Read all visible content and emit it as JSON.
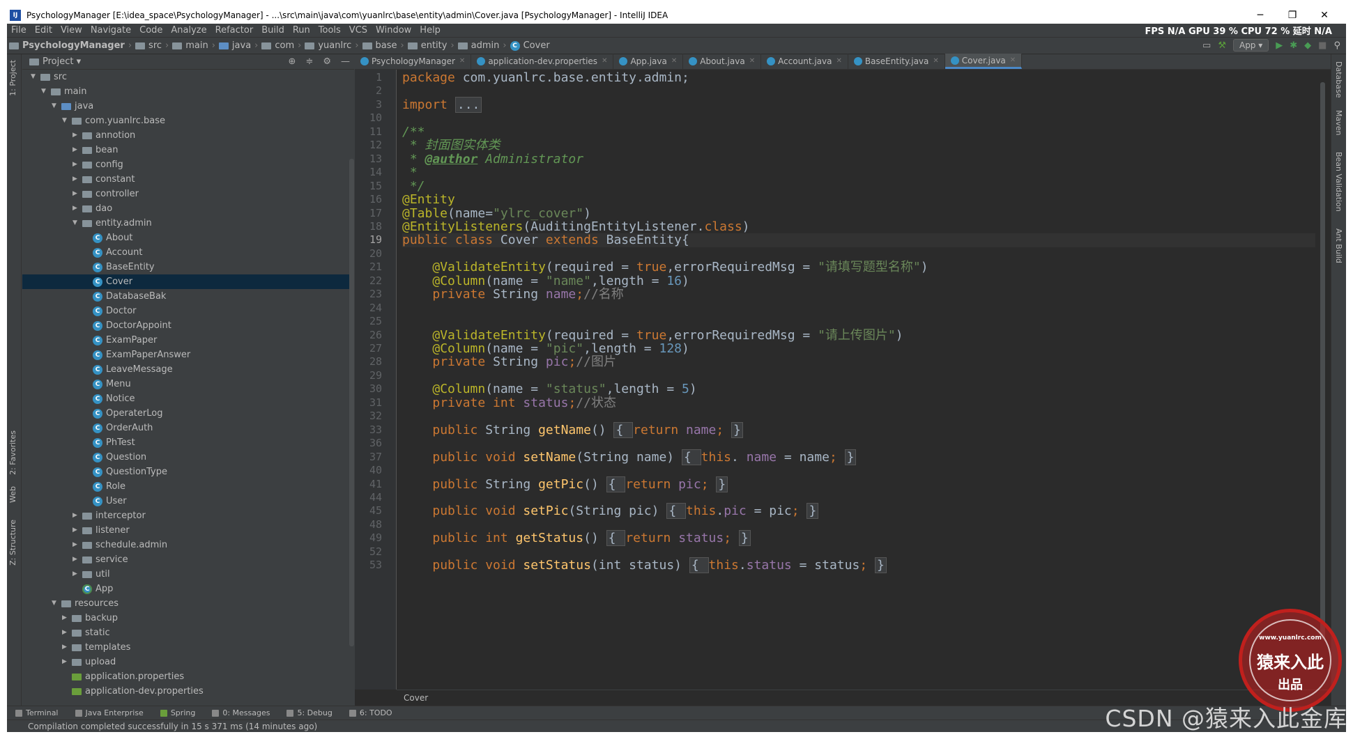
{
  "window": {
    "title": "PsychologyManager [E:\\idea_space\\PsychologyManager] - ...\\src\\main\\java\\com\\yuanlrc\\base\\entity\\admin\\Cover.java [PsychologyManager] - IntelliJ IDEA",
    "app_icon": "IJ",
    "minimize": "─",
    "restore": "❐",
    "close": "✕"
  },
  "menu": {
    "items": [
      "File",
      "Edit",
      "View",
      "Navigate",
      "Code",
      "Analyze",
      "Refactor",
      "Build",
      "Run",
      "Tools",
      "VCS",
      "Window",
      "Help"
    ],
    "stats": "FPS N/A GPU 39 % CPU 72 % 延时 N/A"
  },
  "nav": {
    "crumbs": [
      "PsychologyManager",
      "src",
      "main",
      "java",
      "com",
      "yuanlrc",
      "base",
      "entity",
      "admin",
      "Cover"
    ],
    "run_config": "App ▾"
  },
  "left_strip": {
    "project": "1: Project",
    "favorites": "2: Favorites",
    "web": "Web",
    "structure": "Z: Structure"
  },
  "right_strip": {
    "database": "Database",
    "maven": "Maven",
    "bean_validation": "Bean Validation",
    "ant_build": "Ant Build"
  },
  "project_panel": {
    "title": "Project ▾",
    "tree": [
      {
        "label": "src",
        "depth": 0,
        "type": "folder",
        "open": true
      },
      {
        "label": "main",
        "depth": 1,
        "type": "folder",
        "open": true
      },
      {
        "label": "java",
        "depth": 2,
        "type": "folder-blue",
        "open": true
      },
      {
        "label": "com.yuanlrc.base",
        "depth": 3,
        "type": "folder",
        "open": true
      },
      {
        "label": "annotion",
        "depth": 4,
        "type": "folder",
        "open": false
      },
      {
        "label": "bean",
        "depth": 4,
        "type": "folder",
        "open": false
      },
      {
        "label": "config",
        "depth": 4,
        "type": "folder",
        "open": false
      },
      {
        "label": "constant",
        "depth": 4,
        "type": "folder",
        "open": false
      },
      {
        "label": "controller",
        "depth": 4,
        "type": "folder",
        "open": false
      },
      {
        "label": "dao",
        "depth": 4,
        "type": "folder",
        "open": false
      },
      {
        "label": "entity.admin",
        "depth": 4,
        "type": "folder",
        "open": true
      },
      {
        "label": "About",
        "depth": 5,
        "type": "class"
      },
      {
        "label": "Account",
        "depth": 5,
        "type": "class"
      },
      {
        "label": "BaseEntity",
        "depth": 5,
        "type": "class"
      },
      {
        "label": "Cover",
        "depth": 5,
        "type": "class",
        "selected": true
      },
      {
        "label": "DatabaseBak",
        "depth": 5,
        "type": "class"
      },
      {
        "label": "Doctor",
        "depth": 5,
        "type": "class"
      },
      {
        "label": "DoctorAppoint",
        "depth": 5,
        "type": "class"
      },
      {
        "label": "ExamPaper",
        "depth": 5,
        "type": "class"
      },
      {
        "label": "ExamPaperAnswer",
        "depth": 5,
        "type": "class"
      },
      {
        "label": "LeaveMessage",
        "depth": 5,
        "type": "class"
      },
      {
        "label": "Menu",
        "depth": 5,
        "type": "class"
      },
      {
        "label": "Notice",
        "depth": 5,
        "type": "class"
      },
      {
        "label": "OperaterLog",
        "depth": 5,
        "type": "class"
      },
      {
        "label": "OrderAuth",
        "depth": 5,
        "type": "class"
      },
      {
        "label": "PhTest",
        "depth": 5,
        "type": "class"
      },
      {
        "label": "Question",
        "depth": 5,
        "type": "class"
      },
      {
        "label": "QuestionType",
        "depth": 5,
        "type": "class"
      },
      {
        "label": "Role",
        "depth": 5,
        "type": "class"
      },
      {
        "label": "User",
        "depth": 5,
        "type": "class"
      },
      {
        "label": "interceptor",
        "depth": 4,
        "type": "folder",
        "open": false
      },
      {
        "label": "listener",
        "depth": 4,
        "type": "folder",
        "open": false
      },
      {
        "label": "schedule.admin",
        "depth": 4,
        "type": "folder",
        "open": false
      },
      {
        "label": "service",
        "depth": 4,
        "type": "folder",
        "open": false
      },
      {
        "label": "util",
        "depth": 4,
        "type": "folder",
        "open": false
      },
      {
        "label": "App",
        "depth": 4,
        "type": "app"
      },
      {
        "label": "resources",
        "depth": 2,
        "type": "folder",
        "open": true
      },
      {
        "label": "backup",
        "depth": 3,
        "type": "folder",
        "open": false
      },
      {
        "label": "static",
        "depth": 3,
        "type": "folder",
        "open": false
      },
      {
        "label": "templates",
        "depth": 3,
        "type": "folder",
        "open": false
      },
      {
        "label": "upload",
        "depth": 3,
        "type": "folder",
        "open": false
      },
      {
        "label": "application.properties",
        "depth": 3,
        "type": "props"
      },
      {
        "label": "application-dev.properties",
        "depth": 3,
        "type": "props"
      }
    ]
  },
  "editor": {
    "tabs": [
      {
        "label": "PsychologyManager",
        "active": false
      },
      {
        "label": "application-dev.properties",
        "active": false
      },
      {
        "label": "App.java",
        "active": false
      },
      {
        "label": "About.java",
        "active": false
      },
      {
        "label": "Account.java",
        "active": false
      },
      {
        "label": "BaseEntity.java",
        "active": false
      },
      {
        "label": "Cover.java",
        "active": true
      }
    ],
    "current_line": "19",
    "breadcrumb": "Cover",
    "lines": [
      {
        "n": "1",
        "tokens": [
          [
            "kw",
            "package "
          ],
          [
            "",
            "com.yuanlrc.base.entity.admin;"
          ]
        ]
      },
      {
        "n": "2",
        "tokens": []
      },
      {
        "n": "3",
        "tokens": [
          [
            "kw",
            "import "
          ],
          [
            "fb",
            "..."
          ]
        ]
      },
      {
        "n": "10",
        "tokens": []
      },
      {
        "n": "11",
        "tokens": [
          [
            "doc",
            "/**"
          ]
        ]
      },
      {
        "n": "12",
        "tokens": [
          [
            "doc",
            " * 封面图实体类"
          ]
        ]
      },
      {
        "n": "13",
        "tokens": [
          [
            "doc",
            " * "
          ],
          [
            "tag",
            "@author"
          ],
          [
            "doc",
            " Administrator"
          ]
        ]
      },
      {
        "n": "14",
        "tokens": [
          [
            "doc",
            " *"
          ]
        ]
      },
      {
        "n": "15",
        "tokens": [
          [
            "doc",
            " */"
          ]
        ]
      },
      {
        "n": "16",
        "tokens": [
          [
            "an",
            "@Entity"
          ]
        ]
      },
      {
        "n": "17",
        "tokens": [
          [
            "an",
            "@Table"
          ],
          [
            "",
            "(name="
          ],
          [
            "str",
            "\"ylrc_cover\""
          ],
          [
            "",
            ")"
          ]
        ]
      },
      {
        "n": "18",
        "tokens": [
          [
            "an",
            "@EntityListeners"
          ],
          [
            "",
            "(AuditingEntityListener."
          ],
          [
            "kw",
            "class"
          ],
          [
            "",
            ")"
          ]
        ]
      },
      {
        "n": "19",
        "tokens": [
          [
            "kw",
            "public class "
          ],
          [
            "",
            "Cover "
          ],
          [
            "kw",
            "extends "
          ],
          [
            "",
            "BaseEntity{"
          ]
        ]
      },
      {
        "n": "20",
        "tokens": []
      },
      {
        "n": "21",
        "tokens": [
          [
            "",
            "    "
          ],
          [
            "an",
            "@ValidateEntity"
          ],
          [
            "",
            "(required = "
          ],
          [
            "kw",
            "true"
          ],
          [
            "",
            ",errorRequiredMsg = "
          ],
          [
            "str",
            "\"请填写题型名称\""
          ],
          [
            "",
            ")"
          ]
        ]
      },
      {
        "n": "22",
        "tokens": [
          [
            "",
            "    "
          ],
          [
            "an",
            "@Column"
          ],
          [
            "",
            "(name = "
          ],
          [
            "str",
            "\"name\""
          ],
          [
            "",
            ",length = "
          ],
          [
            "num",
            "16"
          ],
          [
            "",
            ")"
          ]
        ]
      },
      {
        "n": "23",
        "tokens": [
          [
            "",
            "    "
          ],
          [
            "kw",
            "private "
          ],
          [
            "",
            "String "
          ],
          [
            "fld",
            "name"
          ],
          [
            "kw",
            ";"
          ],
          [
            "cm",
            "//名称"
          ]
        ]
      },
      {
        "n": "24",
        "tokens": []
      },
      {
        "n": "25",
        "tokens": []
      },
      {
        "n": "26",
        "tokens": [
          [
            "",
            "    "
          ],
          [
            "an",
            "@ValidateEntity"
          ],
          [
            "",
            "(required = "
          ],
          [
            "kw",
            "true"
          ],
          [
            "",
            ",errorRequiredMsg = "
          ],
          [
            "str",
            "\"请上传图片\""
          ],
          [
            "",
            ")"
          ]
        ]
      },
      {
        "n": "27",
        "tokens": [
          [
            "",
            "    "
          ],
          [
            "an",
            "@Column"
          ],
          [
            "",
            "(name = "
          ],
          [
            "str",
            "\"pic\""
          ],
          [
            "",
            ",length = "
          ],
          [
            "num",
            "128"
          ],
          [
            "",
            ")"
          ]
        ]
      },
      {
        "n": "28",
        "tokens": [
          [
            "",
            "    "
          ],
          [
            "kw",
            "private "
          ],
          [
            "",
            "String "
          ],
          [
            "fld",
            "pic"
          ],
          [
            "kw",
            ";"
          ],
          [
            "cm",
            "//图片"
          ]
        ]
      },
      {
        "n": "29",
        "tokens": []
      },
      {
        "n": "30",
        "tokens": [
          [
            "",
            "    "
          ],
          [
            "an",
            "@Column"
          ],
          [
            "",
            "(name = "
          ],
          [
            "str",
            "\"status\""
          ],
          [
            "",
            ",length = "
          ],
          [
            "num",
            "5"
          ],
          [
            "",
            ")"
          ]
        ]
      },
      {
        "n": "31",
        "tokens": [
          [
            "",
            "    "
          ],
          [
            "kw",
            "private int "
          ],
          [
            "fld",
            "status"
          ],
          [
            "kw",
            ";"
          ],
          [
            "cm",
            "//状态"
          ]
        ]
      },
      {
        "n": "32",
        "tokens": []
      },
      {
        "n": "33",
        "tokens": [
          [
            "",
            "    "
          ],
          [
            "kw",
            "public "
          ],
          [
            "",
            "String "
          ],
          [
            "mth",
            "getName"
          ],
          [
            "",
            "() "
          ],
          [
            "fb",
            "{ "
          ],
          [
            "kw",
            "return "
          ],
          [
            "fld",
            "name"
          ],
          [
            "kw",
            "; "
          ],
          [
            "fb",
            "}"
          ]
        ]
      },
      {
        "n": "36",
        "tokens": []
      },
      {
        "n": "37",
        "tokens": [
          [
            "",
            "    "
          ],
          [
            "kw",
            "public void "
          ],
          [
            "mth",
            "setName"
          ],
          [
            "",
            "(String name) "
          ],
          [
            "fb",
            "{ "
          ],
          [
            "kw",
            "this"
          ],
          [
            "",
            ". "
          ],
          [
            "fld",
            "name"
          ],
          [
            "",
            " = name"
          ],
          [
            "kw",
            "; "
          ],
          [
            "fb",
            "}"
          ]
        ]
      },
      {
        "n": "40",
        "tokens": []
      },
      {
        "n": "41",
        "tokens": [
          [
            "",
            "    "
          ],
          [
            "kw",
            "public "
          ],
          [
            "",
            "String "
          ],
          [
            "mth",
            "getPic"
          ],
          [
            "",
            "() "
          ],
          [
            "fb",
            "{ "
          ],
          [
            "kw",
            "return "
          ],
          [
            "fld",
            "pic"
          ],
          [
            "kw",
            "; "
          ],
          [
            "fb",
            "}"
          ]
        ]
      },
      {
        "n": "44",
        "tokens": []
      },
      {
        "n": "45",
        "tokens": [
          [
            "",
            "    "
          ],
          [
            "kw",
            "public void "
          ],
          [
            "mth",
            "setPic"
          ],
          [
            "",
            "(String pic) "
          ],
          [
            "fb",
            "{ "
          ],
          [
            "kw",
            "this"
          ],
          [
            "",
            "."
          ],
          [
            "fld",
            "pic"
          ],
          [
            "",
            " = pic"
          ],
          [
            "kw",
            "; "
          ],
          [
            "fb",
            "}"
          ]
        ]
      },
      {
        "n": "48",
        "tokens": []
      },
      {
        "n": "49",
        "tokens": [
          [
            "",
            "    "
          ],
          [
            "kw",
            "public int "
          ],
          [
            "mth",
            "getStatus"
          ],
          [
            "",
            "() "
          ],
          [
            "fb",
            "{ "
          ],
          [
            "kw",
            "return "
          ],
          [
            "fld",
            "status"
          ],
          [
            "kw",
            "; "
          ],
          [
            "fb",
            "}"
          ]
        ]
      },
      {
        "n": "52",
        "tokens": []
      },
      {
        "n": "53",
        "tokens": [
          [
            "",
            "    "
          ],
          [
            "kw",
            "public void "
          ],
          [
            "mth",
            "setStatus"
          ],
          [
            "",
            "(int status) "
          ],
          [
            "fb",
            "{ "
          ],
          [
            "kw",
            "this"
          ],
          [
            "",
            "."
          ],
          [
            "fld",
            "status"
          ],
          [
            "",
            " = status"
          ],
          [
            "kw",
            "; "
          ],
          [
            "fb",
            "}"
          ]
        ]
      }
    ]
  },
  "bottom_tabs": [
    "Terminal",
    "Java Enterprise",
    "Spring",
    "0: Messages",
    "5: Debug",
    "6: TODO"
  ],
  "status": "Compilation completed successfully in 15 s 371 ms (14 minutes ago)",
  "watermark": "CSDN @猿来入此金库",
  "stamp": {
    "url": "www.yuanlrc.com",
    "main": "猿来入此",
    "sub": "出品"
  }
}
